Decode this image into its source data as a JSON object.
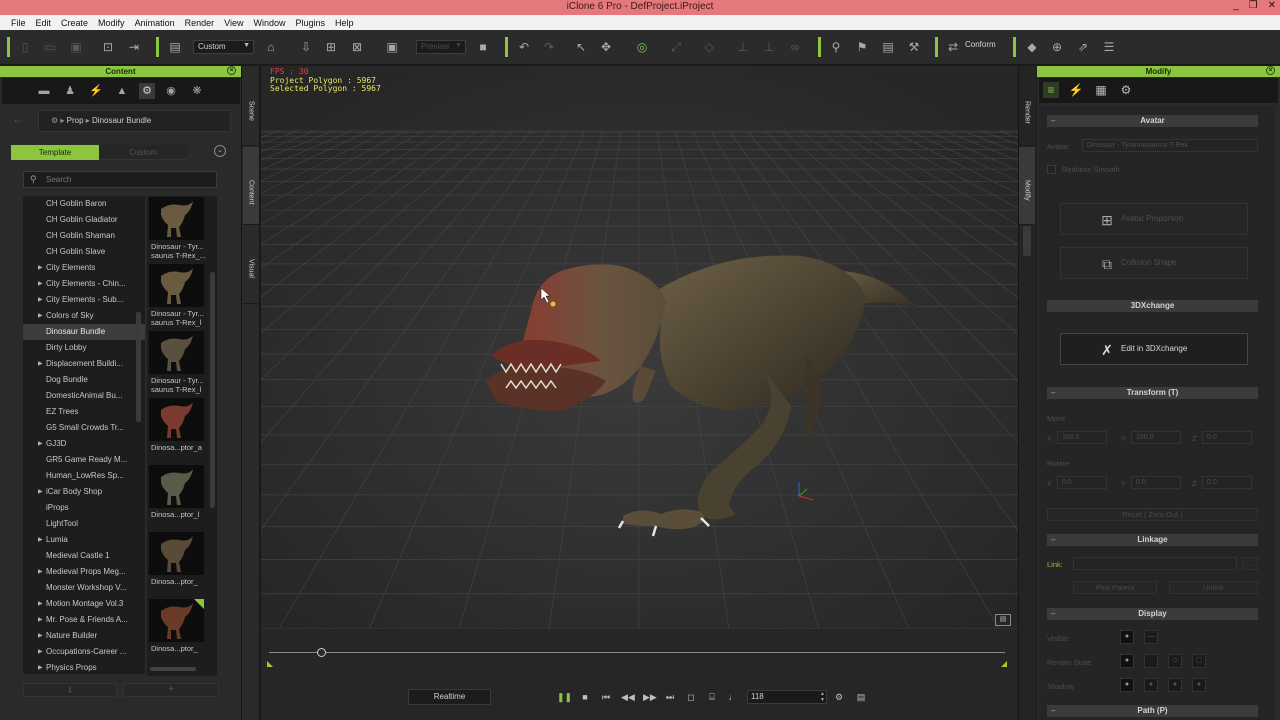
{
  "window": {
    "title": "iClone 6 Pro - DefProject.iProject",
    "controls": [
      "_",
      "❐",
      "✕"
    ]
  },
  "menu": [
    "File",
    "Edit",
    "Create",
    "Modify",
    "Animation",
    "Render",
    "View",
    "Window",
    "Plugins",
    "Help"
  ],
  "toolbar": {
    "layout_select": "Custom",
    "preview_select": "Preview",
    "conform_label": "Conform"
  },
  "content_panel": {
    "title": "Content",
    "breadcrumb": [
      "Prop",
      "Dinosaur Bundle"
    ],
    "tab_template": "Template",
    "tab_custom": "Custom",
    "search_placeholder": "Search",
    "tree": [
      {
        "label": "CH Goblin Baron",
        "arrow": false,
        "selected": false
      },
      {
        "label": "CH Goblin Gladiator",
        "arrow": false,
        "selected": false
      },
      {
        "label": "CH Goblin Shaman",
        "arrow": false,
        "selected": false
      },
      {
        "label": "CH Goblin Slave",
        "arrow": false,
        "selected": false
      },
      {
        "label": "City Elements",
        "arrow": true,
        "selected": false
      },
      {
        "label": "City Elements - Chin...",
        "arrow": true,
        "selected": false
      },
      {
        "label": "City Elements - Sub...",
        "arrow": true,
        "selected": false
      },
      {
        "label": "Colors of Sky",
        "arrow": true,
        "selected": false
      },
      {
        "label": "Dinosaur Bundle",
        "arrow": false,
        "selected": true
      },
      {
        "label": "Dirty Lobby",
        "arrow": false,
        "selected": false
      },
      {
        "label": "Displacement Buildi...",
        "arrow": true,
        "selected": false
      },
      {
        "label": "Dog Bundle",
        "arrow": false,
        "selected": false
      },
      {
        "label": "DomesticAnimal Bu...",
        "arrow": false,
        "selected": false
      },
      {
        "label": "EZ Trees",
        "arrow": false,
        "selected": false
      },
      {
        "label": "G5 Small Crowds Tr...",
        "arrow": false,
        "selected": false
      },
      {
        "label": "GJ3D",
        "arrow": true,
        "selected": false
      },
      {
        "label": "GR5 Game Ready M...",
        "arrow": false,
        "selected": false
      },
      {
        "label": "Human_LowRes Sp...",
        "arrow": false,
        "selected": false
      },
      {
        "label": "iCar Body Shop",
        "arrow": true,
        "selected": false
      },
      {
        "label": "iProps",
        "arrow": false,
        "selected": false
      },
      {
        "label": "LightTool",
        "arrow": false,
        "selected": false
      },
      {
        "label": "Lumia",
        "arrow": true,
        "selected": false
      },
      {
        "label": "Medieval Castle 1",
        "arrow": false,
        "selected": false
      },
      {
        "label": "Medieval Props Meg...",
        "arrow": true,
        "selected": false
      },
      {
        "label": "Monster Workshop V...",
        "arrow": false,
        "selected": false
      },
      {
        "label": "Motion Montage Vol.3",
        "arrow": true,
        "selected": false
      },
      {
        "label": "Mr. Pose & Friends A...",
        "arrow": true,
        "selected": false
      },
      {
        "label": "Nature Builder",
        "arrow": true,
        "selected": false
      },
      {
        "label": "Occupations-Career ...",
        "arrow": true,
        "selected": false
      },
      {
        "label": "Physics Props",
        "arrow": true,
        "selected": false
      }
    ],
    "thumbnails": [
      {
        "cap1": "Dinosaur - Tyr...",
        "cap2": "saurus T-Rex_..."
      },
      {
        "cap1": "Dinosaur - Tyr...",
        "cap2": "saurus T-Rex_l"
      },
      {
        "cap1": "Dinosaur - Tyr...",
        "cap2": "saurus T-Rex_l"
      },
      {
        "cap1": "Dinosa...ptor_a",
        "cap2": ""
      },
      {
        "cap1": "Dinosa...ptor_l",
        "cap2": ""
      },
      {
        "cap1": "Dinosa...ptor_",
        "cap2": ""
      },
      {
        "cap1": "Dinosa...ptor_",
        "cap2": ""
      }
    ]
  },
  "side_tabs": [
    "Scene",
    "Content",
    "Visual"
  ],
  "right_side_tabs": [
    "Render",
    "Modify"
  ],
  "viewport": {
    "fps": "FPS : 30",
    "project_polygon": "Project Polygon : 5967",
    "selected_polygon": "Selected Polygon : 5967"
  },
  "timeline": {
    "realtime_label": "Realtime",
    "frame": "118"
  },
  "modify_panel": {
    "title": "Modify",
    "avatar_section": "Avatar",
    "avatar_label": "Avatar",
    "avatar_value": "Dinosaur - Tyrannosaurus T-Rex",
    "realtime_smooth": "Realtime Smooth",
    "avatar_proportion": "Avatar Proportion",
    "collision_shape": "Collision Shape",
    "threedx_section": "3DXchange",
    "edit_in_3dx": "Edit in 3DXchange",
    "transform_section": "Transform  (T)",
    "move_label": "Move",
    "rotate_label": "Rotate",
    "x": "X",
    "y": "Y",
    "z": "Z",
    "move_x": "100.0",
    "move_y": "100.0",
    "move_z": "0.0",
    "rot_x": "0.0",
    "rot_y": "0.0",
    "rot_z": "0.0",
    "reset_label": "Reset ( Zero Out )",
    "linkage_section": "Linkage",
    "link_label": "Link:",
    "link_more": "...",
    "pick_parent": "Pick Parent",
    "unlink": "Unlink",
    "display_section": "Display",
    "visible_label": "Visible",
    "render_state_label": "Render State",
    "shadow_label": "Shadow",
    "path_section": "Path  (P)"
  },
  "colors": {
    "accent": "#8cc63f",
    "titlebar": "#e5787c",
    "stats_text": "#e8e860"
  }
}
